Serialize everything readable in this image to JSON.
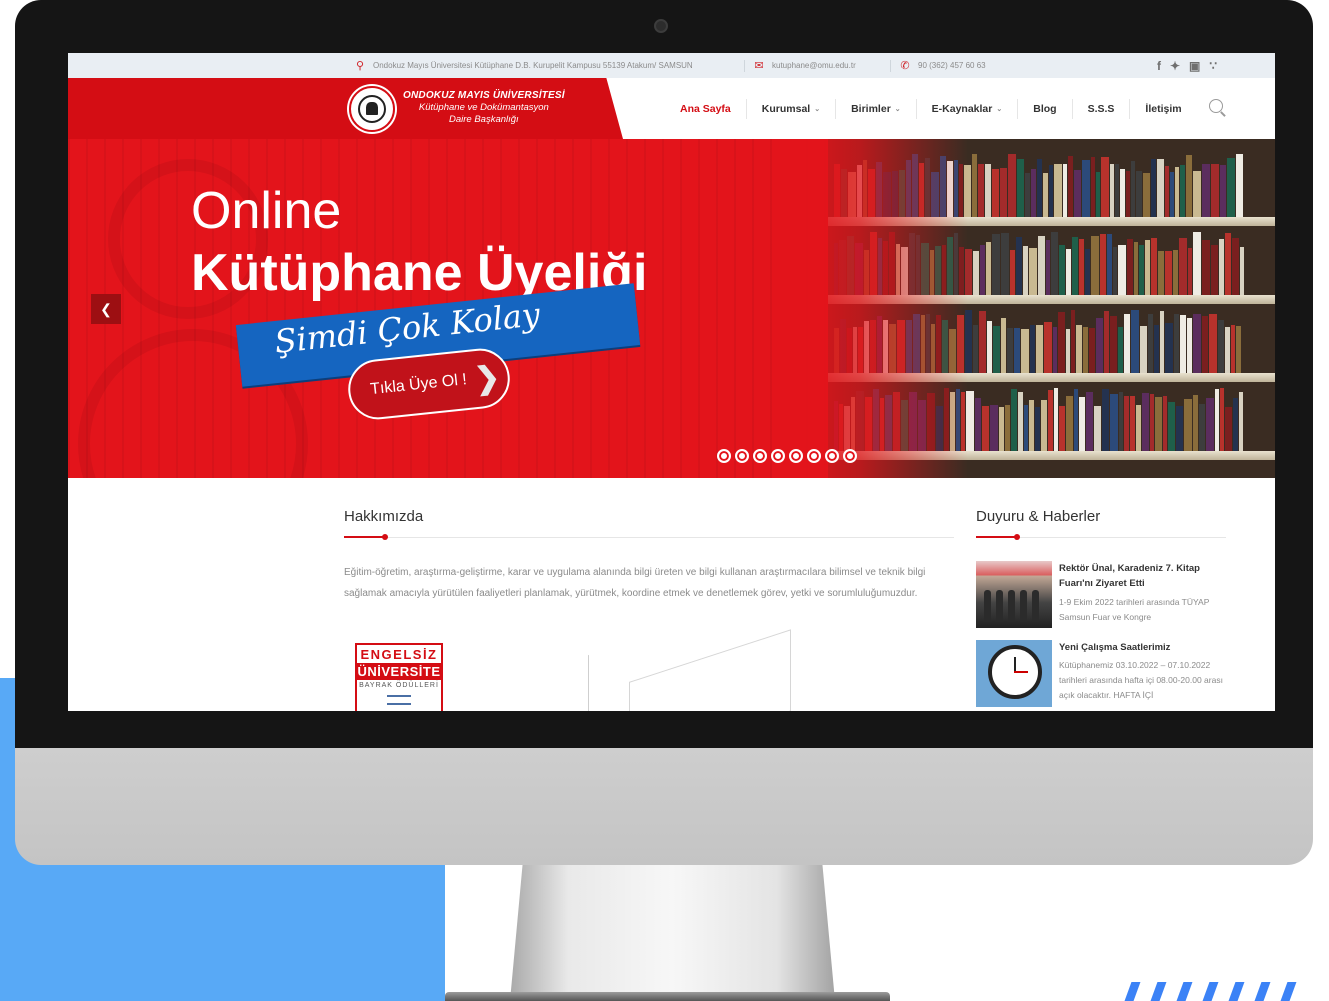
{
  "topbar": {
    "address": "Ondokuz Mayıs Üniversitesi Kütüphane D.B. Kurupelit Kampusu 55139 Atakum/ SAMSUN",
    "email": "kutuphane@omu.edu.tr",
    "phone": "90 (362) 457 60 63",
    "address_icon": "map-pin-icon",
    "email_icon": "envelope-icon",
    "phone_icon": "phone-icon",
    "social_icons": [
      "facebook-icon",
      "twitter-icon",
      "instagram-icon",
      "rss-icon"
    ]
  },
  "brand": {
    "line1": "ONDOKUZ MAYIS ÜNİVERSİTESİ",
    "line2": "Kütüphane ve Dokümantasyon",
    "line3": "Daire Başkanlığı"
  },
  "nav": {
    "items": [
      {
        "label": "Ana Sayfa",
        "active": true,
        "dropdown": false
      },
      {
        "label": "Kurumsal",
        "active": false,
        "dropdown": true
      },
      {
        "label": "Birimler",
        "active": false,
        "dropdown": true
      },
      {
        "label": "E-Kaynaklar",
        "active": false,
        "dropdown": true
      },
      {
        "label": "Blog",
        "active": false,
        "dropdown": false
      },
      {
        "label": "S.S.S",
        "active": false,
        "dropdown": false
      },
      {
        "label": "İletişim",
        "active": false,
        "dropdown": false
      }
    ]
  },
  "slider": {
    "line1": "Online",
    "line2": "Kütüphane Üyeliği",
    "banner": "Şimdi Çok Kolay",
    "cta": "Tıkla Üye Ol !",
    "dots_count": 8,
    "prev_icon": "chevron-left-icon"
  },
  "about": {
    "title": "Hakkımızda",
    "text": "Eğitim-öğretim, araştırma-geliştirme, karar ve uygulama alanında bilgi üreten ve bilgi kullanan araştırmacılara bilimsel ve teknik bilgi sağlamak amacıyla yürütülen faaliyetleri planlamak, yürütmek, koordine etmek ve denetlemek görev, yetki ve sorumluluğumuzdur.",
    "award": {
      "line1": "ENGELSİZ",
      "line2": "ÜNİVERSİTE",
      "line3": "BAYRAK ÖDÜLLERİ"
    }
  },
  "news": {
    "title": "Duyuru & Haberler",
    "items": [
      {
        "title": "Rektör Ünal, Karadeniz 7. Kitap Fuarı'nı Ziyaret Etti",
        "body": "1-9 Ekim 2022 tarihleri arasında TÜYAP Samsun Fuar ve Kongre"
      },
      {
        "title": "Yeni Çalışma Saatlerimiz",
        "body": "Kütüphanemiz 03.10.2022 – 07.10.2022 tarihleri arasında hafta içi 08.00-20.00 arası açık olacaktır. HAFTA İÇİ"
      }
    ]
  },
  "colors": {
    "brand_red": "#d40d14",
    "banner_blue": "#1565c0",
    "accent_blue": "#58a9f6"
  }
}
